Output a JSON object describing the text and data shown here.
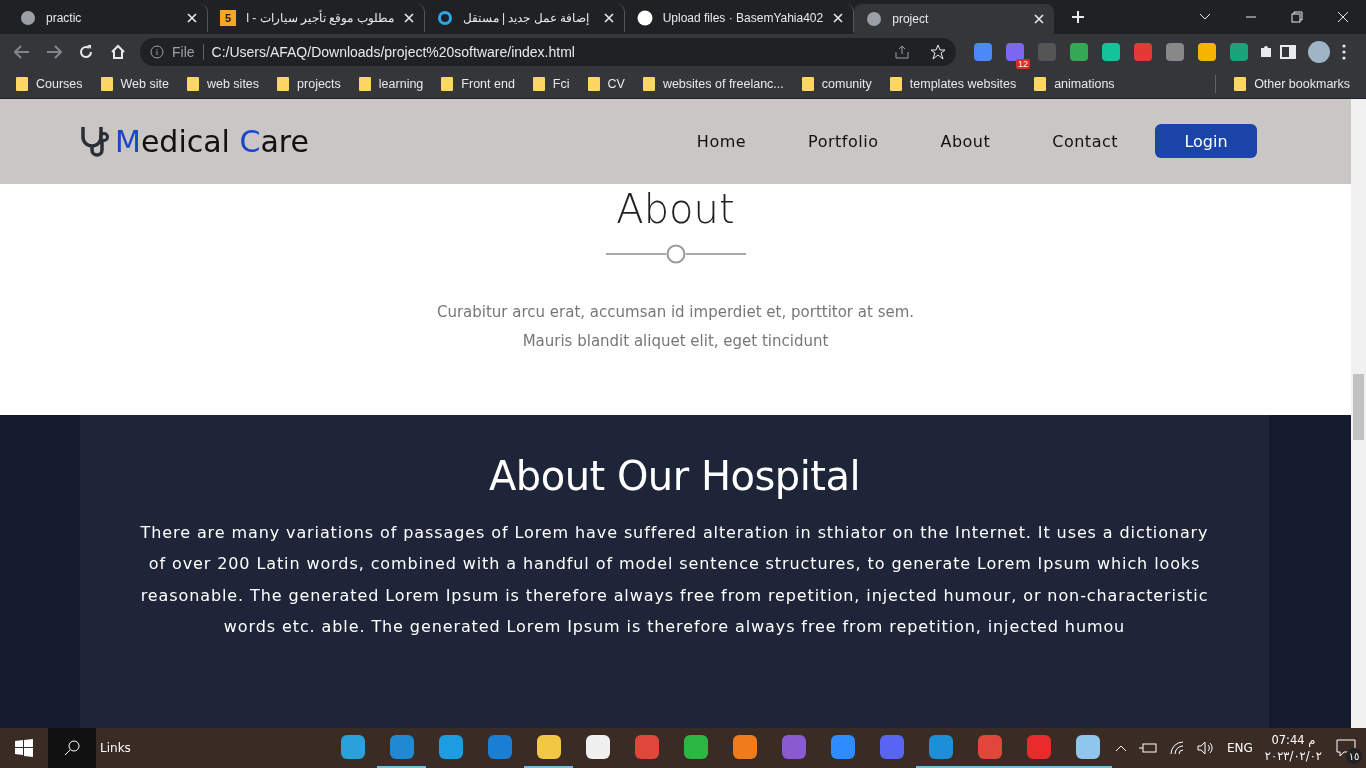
{
  "browser": {
    "tabs": [
      {
        "title": "practic",
        "selected": false
      },
      {
        "title": "مطلوب موقع تأجير سيارات - ا",
        "badge": "5",
        "selected": false
      },
      {
        "title": "إضافة عمل جديد | مستقل",
        "selected": false
      },
      {
        "title": "Upload files · BasemYahia402",
        "selected": false
      },
      {
        "title": "project",
        "selected": true
      }
    ],
    "address": {
      "scheme": "File",
      "url": "C:/Users/AFAQ/Downloads/project%20software/index.html"
    },
    "extension_badge": "12",
    "bookmarks": [
      "Courses",
      "Web site",
      "web sites",
      "projects",
      "learning",
      "Front end",
      "Fci",
      "CV",
      "websites of freelanc...",
      "comunity",
      "templates websites",
      "animations"
    ],
    "other_bookmarks": "Other bookmarks"
  },
  "site": {
    "logo": [
      {
        "text": "M",
        "accent": true
      },
      {
        "text": "edical ",
        "accent": false
      },
      {
        "text": "C",
        "accent": true
      },
      {
        "text": "are",
        "accent": false
      }
    ],
    "nav": [
      "Home",
      "Portfolio",
      "About",
      "Contact"
    ],
    "login": "Login",
    "about": {
      "title": "About",
      "lines": [
        "Curabitur arcu erat, accumsan id imperdiet et, porttitor at sem.",
        "Mauris blandit aliquet elit, eget tincidunt"
      ]
    },
    "hospital": {
      "title": "About Our Hospital",
      "text": "There are many variations of passages of Lorem have suffered alteration in sthiator on the Internet. It uses a dictionary of over 200 Latin words, combined with a handful of model sentence structures, to generate Lorem Ipsum which looks reasonable. The generated Lorem Ipsum is therefore always free from repetition, injected humour, or non-characteristic words etc. able. The generated Lorem Ipsum is therefore always free from repetition, injected humou"
    }
  },
  "taskbar": {
    "search": "Links",
    "apps": [
      {
        "running": false
      },
      {
        "running": true
      },
      {
        "running": false
      },
      {
        "running": false
      },
      {
        "running": true
      },
      {
        "running": false
      },
      {
        "running": false
      },
      {
        "running": false
      },
      {
        "running": false
      },
      {
        "running": false
      },
      {
        "running": false
      },
      {
        "running": false
      },
      {
        "running": true
      },
      {
        "running": true
      },
      {
        "running": true
      },
      {
        "running": true
      }
    ],
    "lang": "ENG",
    "time": "07:44 م",
    "date": "٢٠٢٣/٠٢/٠٢",
    "notifications": "١٥"
  }
}
